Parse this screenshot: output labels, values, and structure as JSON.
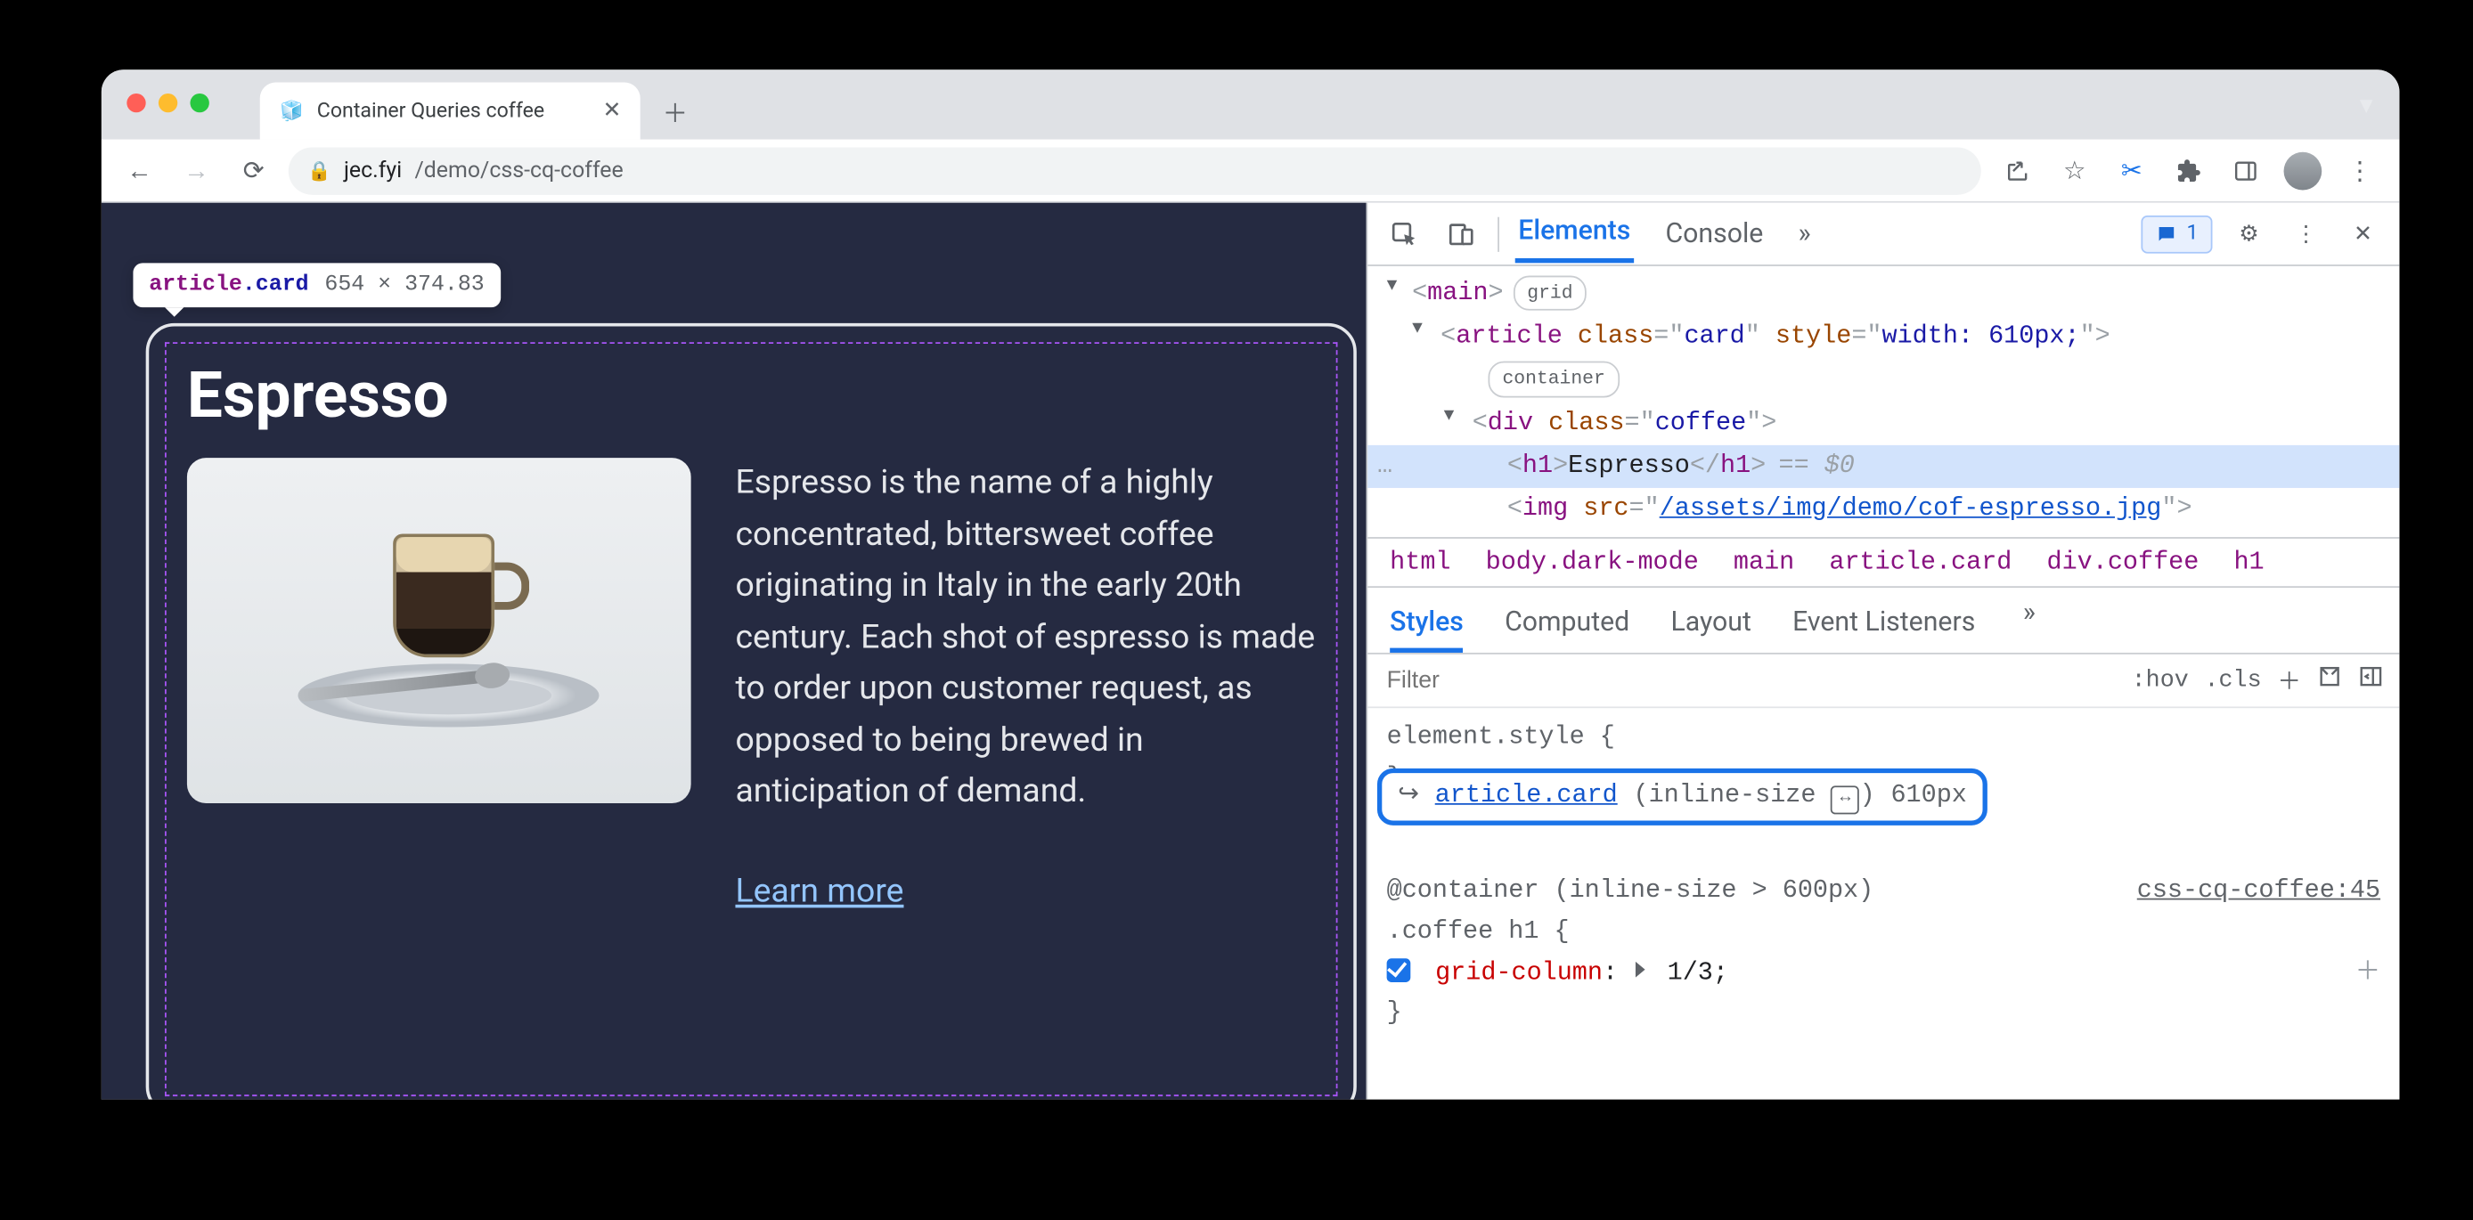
{
  "browser": {
    "tab_title": "Container Queries coffee",
    "url_host": "jec.fyi",
    "url_path": "/demo/css-cq-coffee",
    "chevron_label": "▼"
  },
  "inspector_tooltip": {
    "tag": "article",
    "cls": ".card",
    "dimensions": "654 × 374.83"
  },
  "page": {
    "heading": "Espresso",
    "description": "Espresso is the name of a highly concentrated, bittersweet coffee originating in Italy in the early 20th century. Each shot of espresso is made to order upon customer request, as opposed to being brewed in anticipation of demand.",
    "learn_more": "Learn more"
  },
  "devtools": {
    "tabs": {
      "elements": "Elements",
      "console": "Console"
    },
    "issues_count": "1",
    "tree": {
      "main_open": "<main>",
      "main_badge": "grid",
      "article_open": "<article class=\"card\" style=\"width: 610px;\">",
      "article_badge": "container",
      "div_open": "<div class=\"coffee\">",
      "h1": "<h1>Espresso</h1>",
      "eq0": "== $0",
      "img_prefix": "<img src=\"",
      "img_src": "/assets/img/demo/cof-espresso.jpg",
      "img_suffix": "\">"
    },
    "crumbs": [
      "html",
      "body.dark-mode",
      "main",
      "article.card",
      "div.coffee",
      "h1"
    ],
    "styles_tabs": {
      "styles": "Styles",
      "computed": "Computed",
      "layout": "Layout",
      "listeners": "Event Listeners"
    },
    "filter_placeholder": "Filter",
    "hov": ":hov",
    "cls": ".cls",
    "element_style": "element.style {",
    "close_brace": "}",
    "highlight": {
      "selector": "article.card",
      "meta_open": "(inline-size",
      "meta_close": ")",
      "size": "610px"
    },
    "container_line": "@container (inline-size > 600px)",
    "rule_selector": ".coffee h1 {",
    "source": "css-cq-coffee:45",
    "prop_name": "grid-column",
    "prop_value": "1/3;"
  }
}
